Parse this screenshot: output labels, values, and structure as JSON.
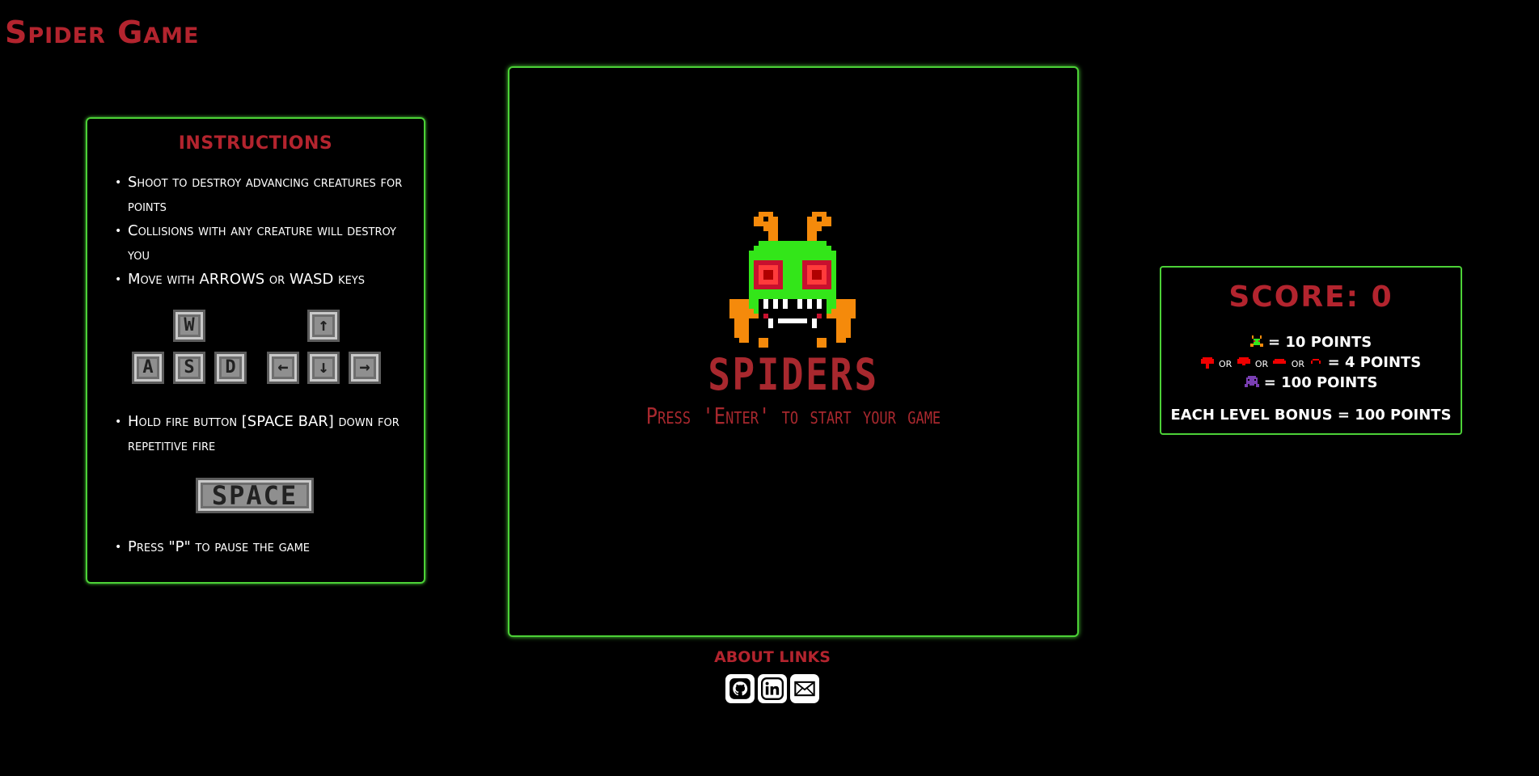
{
  "page": {
    "title": "Spider Game"
  },
  "instructions": {
    "heading": "INSTRUCTIONS",
    "items": [
      "Shoot to destroy advancing creatures for points",
      "Collisions with any creature will destroy you",
      "Move with ARROWS or WASD keys",
      "Hold fire button [SPACE BAR] down for repetitive fire",
      "Press \"P\" to pause the game"
    ],
    "wasd_keys": [
      "W",
      "A",
      "S",
      "D"
    ],
    "arrow_keys": [
      "↑",
      "←",
      "↓",
      "→"
    ],
    "space_key": "SPACE"
  },
  "game": {
    "logo_title": "SPIDERS",
    "prompt": "Press 'Enter' to start your game"
  },
  "score": {
    "title": "SCORE: 0",
    "spider_points": "= 10 POINTS",
    "mushroom_or": "or",
    "mushroom_points": "= 4 POINTS",
    "alien_points": "= 100 POINTS",
    "level_bonus": "EACH LEVEL BONUS = 100 POINTS"
  },
  "about": {
    "title": "ABOUT LINKS",
    "links": [
      "github-icon",
      "linkedin-icon",
      "email-icon"
    ]
  },
  "colors": {
    "accent_red": "#b3242e",
    "border_green": "#4cd137",
    "background": "#000000"
  }
}
